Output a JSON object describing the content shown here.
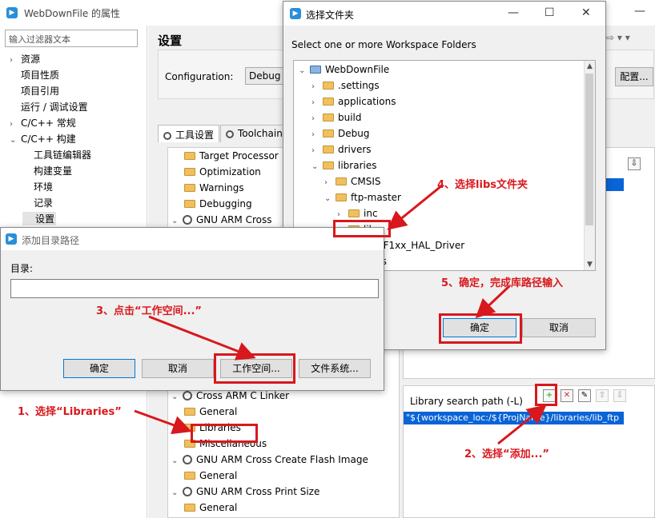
{
  "main_window": {
    "title": "WebDownFile 的属性",
    "filter_placeholder": "输入过滤器文本",
    "nav": [
      {
        "label": "资源",
        "chevron": "›",
        "indent": 0
      },
      {
        "label": "项目性质",
        "chevron": "",
        "indent": 0
      },
      {
        "label": "项目引用",
        "chevron": "",
        "indent": 0
      },
      {
        "label": "运行 / 调试设置",
        "chevron": "",
        "indent": 0
      },
      {
        "label": "C/C++ 常规",
        "chevron": "›",
        "indent": 0
      },
      {
        "label": "C/C++ 构建",
        "chevron": "⌄",
        "indent": 0
      },
      {
        "label": "工具链编辑器",
        "chevron": "",
        "indent": 1
      },
      {
        "label": "构建变量",
        "chevron": "",
        "indent": 1
      },
      {
        "label": "环境",
        "chevron": "",
        "indent": 1
      },
      {
        "label": "记录",
        "chevron": "",
        "indent": 1
      },
      {
        "label": "设置",
        "chevron": "",
        "indent": 1
      }
    ],
    "settings_heading": "设置",
    "configuration_label": "Configuration:",
    "configuration_value": "Debug  [",
    "manage_btn_partial": "配置...",
    "tabs": [
      "工具设置",
      "Toolchain"
    ],
    "tool_tree": [
      {
        "label": "Target Processor",
        "type": "folder",
        "indent": 1
      },
      {
        "label": "Optimization",
        "type": "folder",
        "indent": 1
      },
      {
        "label": "Warnings",
        "type": "folder",
        "indent": 1
      },
      {
        "label": "Debugging",
        "type": "folder",
        "indent": 1
      },
      {
        "label": "GNU ARM Cross",
        "type": "gear",
        "indent": 0
      },
      {
        "label": "Cross ARM C Linker",
        "type": "gear",
        "indent": 0
      },
      {
        "label": "General",
        "type": "folder",
        "indent": 1
      },
      {
        "label": "Libraries",
        "type": "folder",
        "indent": 1
      },
      {
        "label": "Miscellaneous",
        "type": "folder",
        "indent": 1
      },
      {
        "label": "GNU ARM Cross Create Flash Image",
        "type": "gear",
        "indent": 0
      },
      {
        "label": "General",
        "type": "folder",
        "indent": 1
      },
      {
        "label": "GNU ARM Cross Print Size",
        "type": "gear",
        "indent": 0
      },
      {
        "label": "General",
        "type": "folder",
        "indent": 1
      }
    ],
    "library_search_label": "Library search path (-L)",
    "library_search_value": "\"${workspace_loc:/${ProjName}/libraries/lib_ftp"
  },
  "folder_dialog": {
    "title": "选择文件夹",
    "prompt": "Select one or more Workspace Folders",
    "tree": [
      {
        "label": "WebDownFile",
        "chev": "⌄",
        "indent": 0,
        "project": true
      },
      {
        "label": ".settings",
        "chev": "›",
        "indent": 1
      },
      {
        "label": "applications",
        "chev": "›",
        "indent": 1
      },
      {
        "label": "build",
        "chev": "›",
        "indent": 1
      },
      {
        "label": "Debug",
        "chev": "›",
        "indent": 1
      },
      {
        "label": "drivers",
        "chev": "›",
        "indent": 1
      },
      {
        "label": "libraries",
        "chev": "⌄",
        "indent": 1
      },
      {
        "label": "CMSIS",
        "chev": "›",
        "indent": 2
      },
      {
        "label": "ftp-master",
        "chev": "⌄",
        "indent": 2
      },
      {
        "label": "inc",
        "chev": "›",
        "indent": 3
      },
      {
        "label": "libs",
        "chev": "›",
        "indent": 3
      },
      {
        "label": "STM32F1xx_HAL_Driver",
        "chev": "›",
        "indent": 2
      },
      {
        "label": "linkscripts",
        "chev": "›",
        "indent": 1
      }
    ],
    "ok": "确定",
    "cancel": "取消"
  },
  "dir_dialog": {
    "title": "添加目录路径",
    "dir_label": "目录:",
    "ok": "确定",
    "cancel": "取消",
    "workspace": "工作空间...",
    "filesystem": "文件系统..."
  },
  "annotations": {
    "step1": "1、选择“Libraries”",
    "step2": "2、选择“添加...”",
    "step3": "3、点击“工作空间...”",
    "step4": "4、选择libs文件夹",
    "step5": "5、确定，完成库路径输入"
  },
  "colors": {
    "annotation": "#d8181c",
    "selection": "#0a64d6",
    "primary_border": "#0078d7"
  }
}
